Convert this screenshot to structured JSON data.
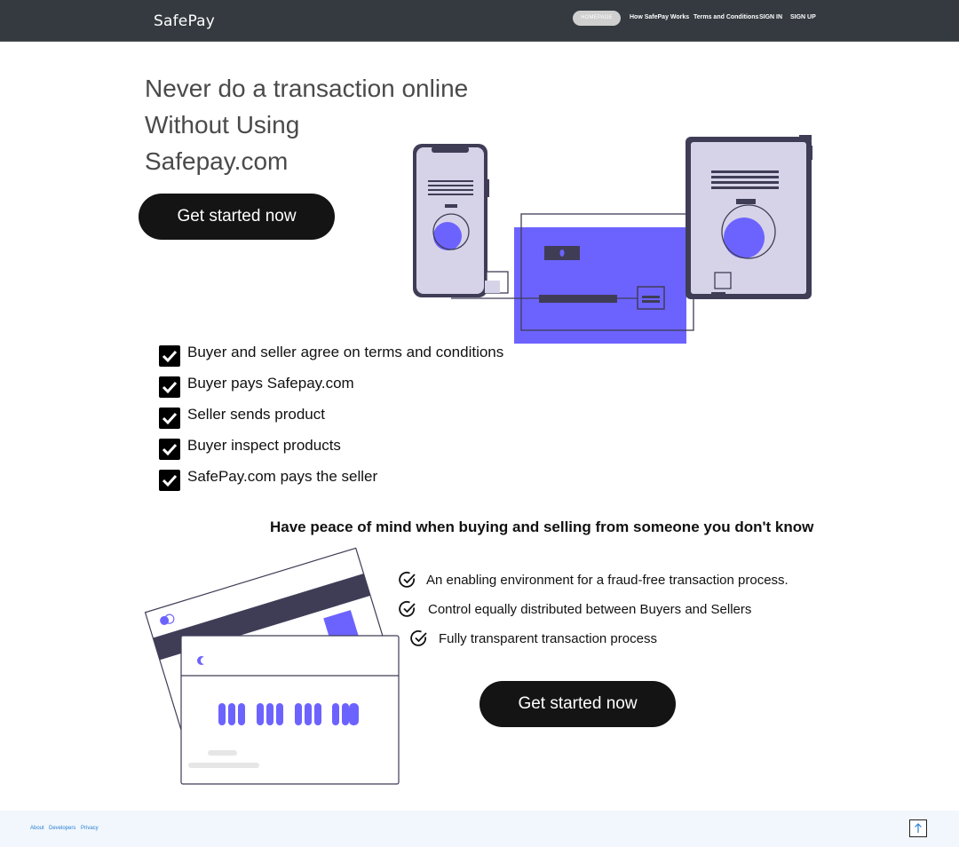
{
  "nav": {
    "brand": "SafePay",
    "links": [
      "HOMEPAGE",
      "How SafePay Works",
      "Terms and Conditions",
      "SIGN IN",
      "SIGN UP"
    ]
  },
  "hero": {
    "title_lines": [
      "Never do a transaction online",
      "Without Using",
      "Safepay.com"
    ],
    "cta_label": "Get started now"
  },
  "steps": [
    "Buyer and seller agree on terms and conditions",
    "Buyer pays Safepay.com",
    "Seller sends product",
    "Buyer inspect products",
    "SafePay.com pays the seller"
  ],
  "peace": {
    "heading": "Have peace of mind when buying and selling from someone you don't know",
    "features": [
      "An enabling environment for a fraud-free transaction process.",
      "Control equally distributed between Buyers and Sellers",
      "Fully transparent transaction process"
    ],
    "cta_label": "Get started now"
  },
  "footer": {
    "links": [
      "About",
      "Developers",
      "Privacy"
    ],
    "to_top_icon": "arrow-up-icon"
  },
  "colors": {
    "navbar": "#343a40",
    "accent": "#6c63ff",
    "button": "#141414",
    "footer_bg": "#f1f7fc",
    "footer_link": "#2a7fd4"
  }
}
